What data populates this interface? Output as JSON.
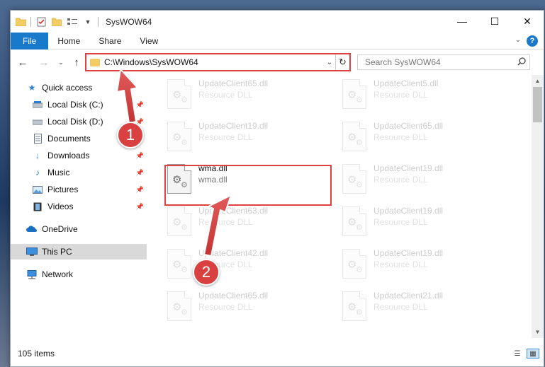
{
  "window": {
    "title": "SysWOW64"
  },
  "ribbon": {
    "tabs": [
      "File",
      "Home",
      "Share",
      "View"
    ],
    "help_label": "?"
  },
  "address_bar": {
    "path": "C:\\Windows\\SysWOW64",
    "search_placeholder": "Search SysWOW64"
  },
  "sidebar": {
    "items": [
      {
        "label": "Quick access",
        "icon": "star-icon",
        "pinned": false
      },
      {
        "label": "Local Disk (C:)",
        "icon": "drive-icon",
        "pinned": true
      },
      {
        "label": "Local Disk (D:)",
        "icon": "drive-icon",
        "pinned": true
      },
      {
        "label": "Documents",
        "icon": "documents-icon",
        "pinned": true
      },
      {
        "label": "Downloads",
        "icon": "download-icon",
        "pinned": true
      },
      {
        "label": "Music",
        "icon": "music-icon",
        "pinned": true
      },
      {
        "label": "Pictures",
        "icon": "pictures-icon",
        "pinned": true
      },
      {
        "label": "Videos",
        "icon": "videos-icon",
        "pinned": true
      },
      {
        "label": "OneDrive",
        "icon": "cloud-icon",
        "pinned": false
      },
      {
        "label": "This PC",
        "icon": "computer-icon",
        "pinned": false,
        "selected": true
      },
      {
        "label": "Network",
        "icon": "network-icon",
        "pinned": false
      }
    ]
  },
  "files": [
    {
      "name": "UpdateClient65.dll",
      "type": "Resource DLL",
      "faded": true
    },
    {
      "name": "UpdateClient5.dll",
      "type": "Resource DLL",
      "faded": true
    },
    {
      "name": "UpdateClient19.dll",
      "type": "Resource DLL",
      "faded": true
    },
    {
      "name": "UpdateClient65.dll",
      "type": "Resource DLL",
      "faded": true
    },
    {
      "name": "wma.dll",
      "type": "wma.dll",
      "faded": false
    },
    {
      "name": "UpdateClient19.dll",
      "type": "Resource DLL",
      "faded": true
    },
    {
      "name": "UpdateClient63.dll",
      "type": "Resource DLL",
      "faded": true
    },
    {
      "name": "UpdateClient19.dll",
      "type": "Resource DLL",
      "faded": true
    },
    {
      "name": "UpdateClient42.dll",
      "type": "Resource DLL",
      "faded": true
    },
    {
      "name": "UpdateClient19.dll",
      "type": "Resource DLL",
      "faded": true
    },
    {
      "name": "UpdateClient65.dll",
      "type": "Resource DLL",
      "faded": true
    },
    {
      "name": "UpdateClient21.dll",
      "type": "Resource DLL",
      "faded": true
    }
  ],
  "status": {
    "item_count": "105 items"
  },
  "annotations": {
    "step1": "1",
    "step2": "2",
    "color": "#d94141"
  },
  "colors": {
    "accent": "#1979ca",
    "highlight": "#e04040"
  }
}
